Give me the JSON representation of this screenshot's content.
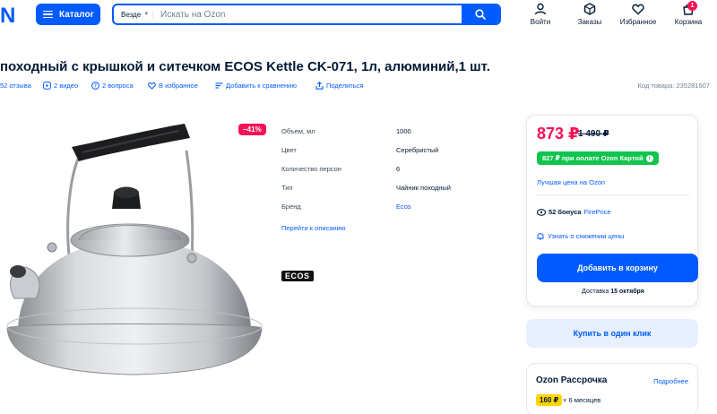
{
  "header": {
    "logo": "N",
    "catalog_label": "Каталог",
    "search_scope": "Везде",
    "search_placeholder": "Искать на Ozon",
    "nav": [
      {
        "label": "Войти",
        "icon": "user-icon"
      },
      {
        "label": "Заказы",
        "icon": "box-icon"
      },
      {
        "label": "Избранное",
        "icon": "heart-icon"
      },
      {
        "label": "Корзина",
        "icon": "cart-icon",
        "badge": "1"
      }
    ]
  },
  "product": {
    "title": "походный с крышкой и ситечком ECOS Kettle CK-071, 1л, алюминий,1 шт.",
    "meta": {
      "reviews": "52 отзыва",
      "videos": "2 видео",
      "questions": "2 вопроса",
      "favorite": "В избранное",
      "compare": "Добавить к сравнению",
      "share": "Поделиться",
      "code": "Код товара: 235281607"
    },
    "discount": "−41%",
    "specs": [
      {
        "name": "Объем, мл",
        "value": "1000"
      },
      {
        "name": "Цвет",
        "value": "Серебристый"
      },
      {
        "name": "Количество персон",
        "value": "6"
      },
      {
        "name": "Тип",
        "value": "Чайник походный"
      },
      {
        "name": "Бренд",
        "value": "Ecos"
      }
    ],
    "to_description": "Перейти к описанию",
    "brand_logo_text": "ECOS"
  },
  "price_card": {
    "price": "873 ₽",
    "old_price": "1 490 ₽",
    "card_price": "827 ₽ при оплате Ozon Картой",
    "best_price": "Лучшая цена на Ozon",
    "bonus_amount": "52 бонуса",
    "bonus_source": "FirePrice",
    "notify": "Узнать о снижении цены",
    "add_to_cart": "Добавить в корзину",
    "delivery_prefix": "Доставка",
    "delivery_date": "15 октября",
    "one_click": "Купить в один клик"
  },
  "installment": {
    "title": "Ozon Рассрочка",
    "more": "Подробнее",
    "amount": "160 ₽",
    "months": "× 6 месяцев"
  },
  "colors": {
    "accent": "#005bff",
    "sale": "#f91155",
    "green": "#10c44c",
    "text": "#001a34"
  }
}
